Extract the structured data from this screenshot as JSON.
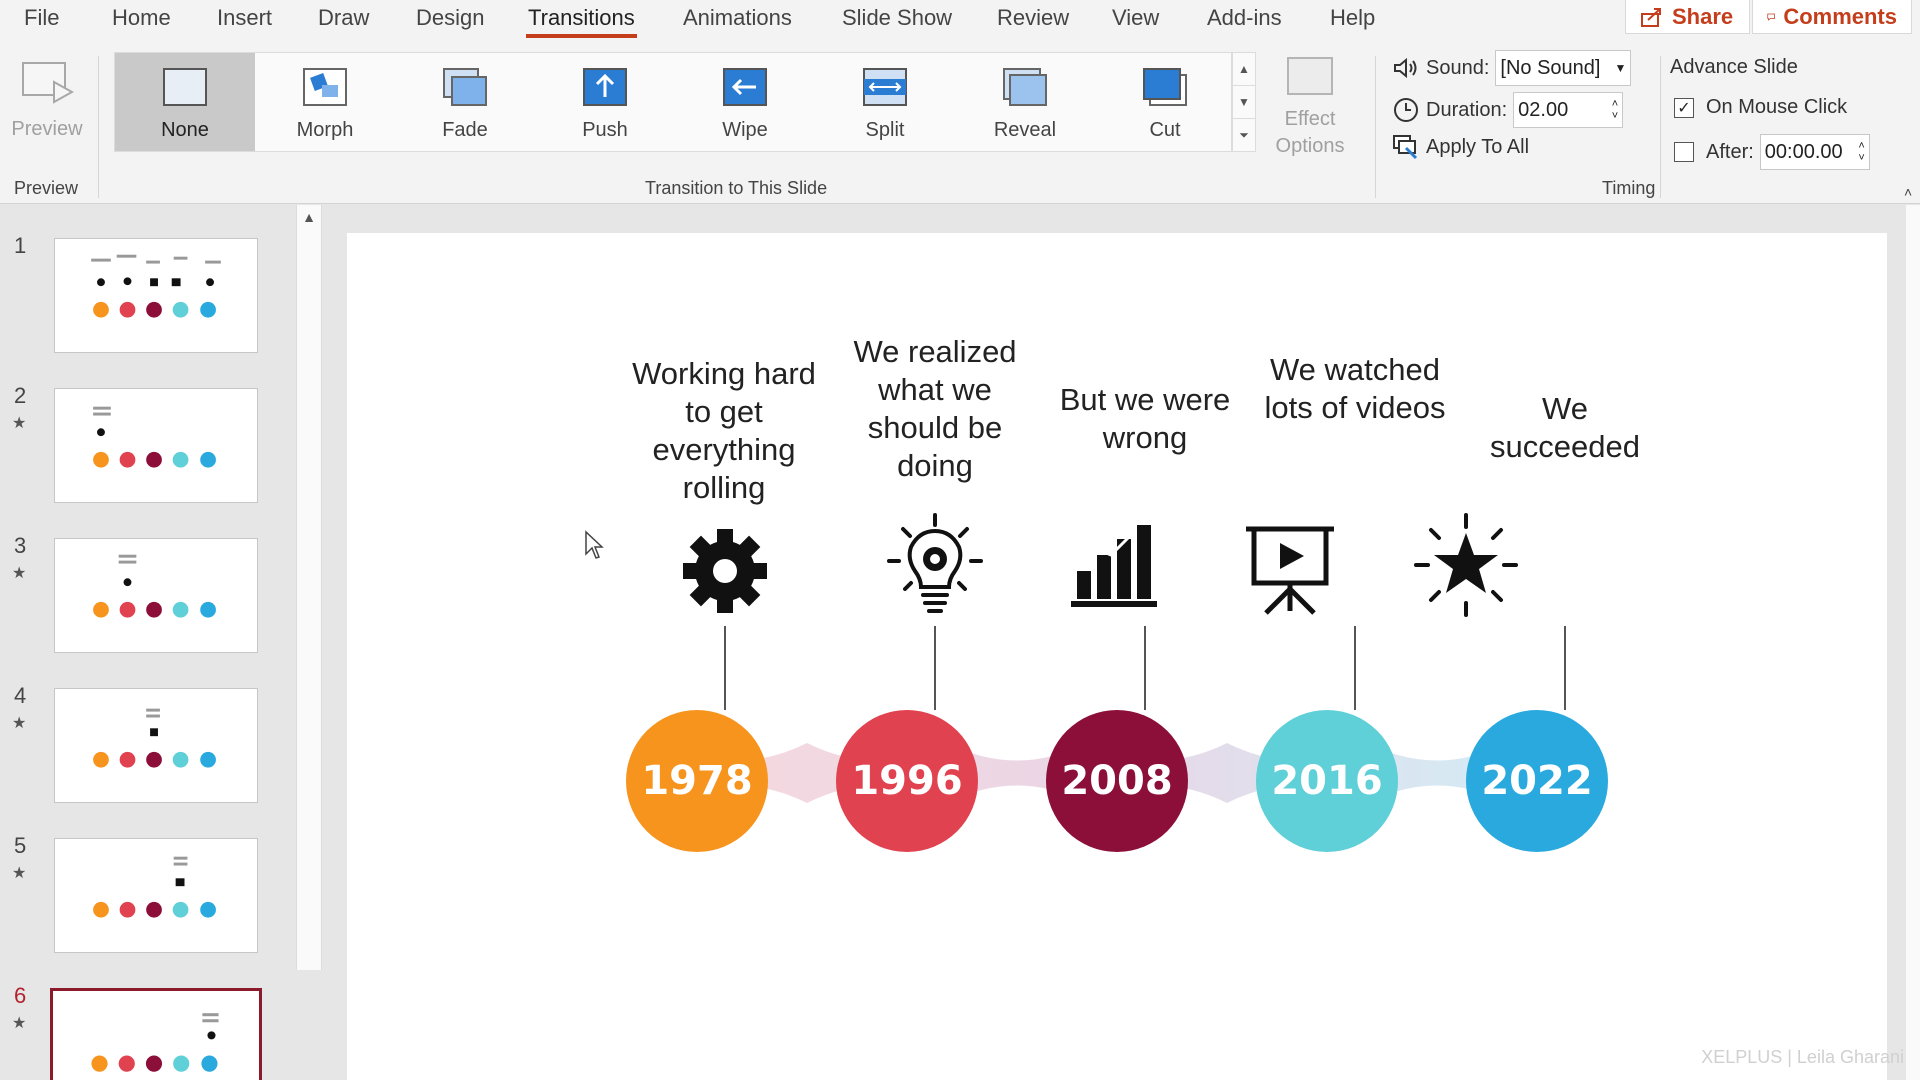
{
  "menu": {
    "tabs": [
      "File",
      "Home",
      "Insert",
      "Draw",
      "Design",
      "Transitions",
      "Animations",
      "Slide Show",
      "Review",
      "View",
      "Add-ins",
      "Help"
    ],
    "active_tab": "Transitions",
    "share_label": "Share",
    "comments_label": "Comments"
  },
  "ribbon": {
    "preview": {
      "button_label": "Preview",
      "group_label": "Preview"
    },
    "transitions": {
      "group_label": "Transition to This Slide",
      "items": [
        "None",
        "Morph",
        "Fade",
        "Push",
        "Wipe",
        "Split",
        "Reveal",
        "Cut"
      ],
      "selected": "None",
      "effect_options_label": "Effect Options"
    },
    "timing": {
      "group_label": "Timing",
      "sound_label": "Sound:",
      "sound_value": "[No Sound]",
      "duration_label": "Duration:",
      "duration_value": "02.00",
      "apply_all_label": "Apply To All",
      "advance_label": "Advance Slide",
      "on_click_label": "On Mouse Click",
      "on_click_checked": true,
      "after_label": "After:",
      "after_value": "00:00.00",
      "after_checked": false
    }
  },
  "thumbnails": [
    {
      "number": "1",
      "star": false
    },
    {
      "number": "2",
      "star": true
    },
    {
      "number": "3",
      "star": true
    },
    {
      "number": "4",
      "star": true
    },
    {
      "number": "5",
      "star": true
    },
    {
      "number": "6",
      "star": true
    }
  ],
  "selected_slide": "6",
  "slide": {
    "milestones": [
      {
        "caption": "Working hard to get everything rolling",
        "year": "1978",
        "color": "#f7941d",
        "icon": "gear-icon"
      },
      {
        "caption": "We realized what we should be doing",
        "year": "1996",
        "color": "#e0424f",
        "icon": "lightbulb-icon"
      },
      {
        "caption": "But we were wrong",
        "year": "2008",
        "color": "#8c0f3a",
        "icon": "bar-chart-icon"
      },
      {
        "caption": "We watched lots of videos",
        "year": "2016",
        "color": "#5fcfd8",
        "icon": "video-presentation-icon"
      },
      {
        "caption": "We succeeded",
        "year": "2022",
        "color": "#2aa9df",
        "icon": "star-burst-icon"
      }
    ],
    "watermark": "XELPLUS | Leila Gharani"
  }
}
